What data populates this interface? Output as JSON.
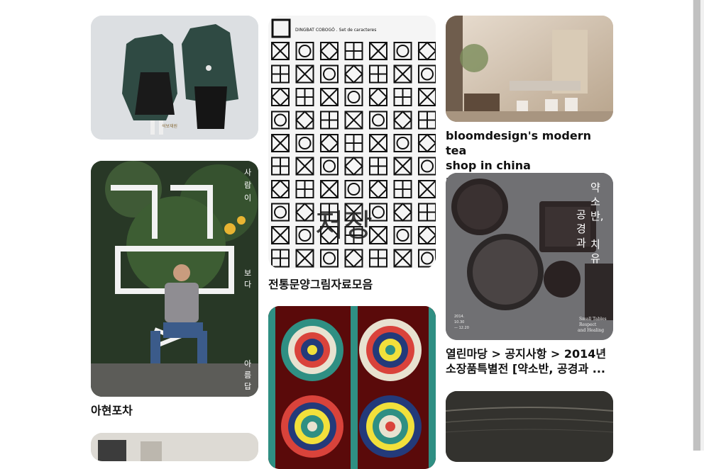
{
  "feed": {
    "pins": [
      {
        "id": "hanbok",
        "title": ""
      },
      {
        "id": "pattern",
        "title": "전통문양그림자료모음",
        "image_header": "DINGBAT COBOGÓ . Set de caracteres",
        "overlay_text": "저장"
      },
      {
        "id": "teashop",
        "title": "bloomdesign's modern tea\nshop in china references..."
      },
      {
        "id": "poster",
        "title": "아현포차"
      },
      {
        "id": "soban",
        "title": "열린마당 > 공지사항 > 2014년\n소장품특별전 [약소반, 공경과 ..."
      }
    ],
    "poster": {
      "vertical_text": "사람이보다아름답다"
    },
    "soban": {
      "vertical_text": "약소반,공경과치유",
      "english_caption": "Small Tables\nRespect\nand Healing",
      "date_text": "2014.\n10.30\n— 12.20"
    }
  },
  "colors": {
    "hanbok_bg": "#d9dcdf",
    "pattern_bg": "#f3f3f3",
    "tea_bg": "#c8b8a4",
    "poster_bg": "#2d3a2a",
    "soban_bg": "#6c6c6e",
    "dancheong_bg": "#5a0a0a"
  }
}
